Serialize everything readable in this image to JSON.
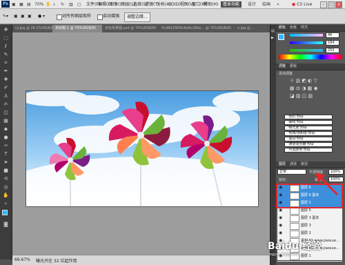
{
  "menubar": {
    "logo": "Ps",
    "menus": [
      "文件(F)",
      "编辑(E)",
      "图像(I)",
      "图层(L)",
      "选择(S)",
      "滤镜(T)",
      "分析(A)",
      "3D(D)",
      "视图(V)",
      "窗口(W)",
      "帮助(H)"
    ],
    "zoom": "70%",
    "workspace_active": "基本功能",
    "workspace_design": "设计",
    "workspace_paint": "绘画",
    "more": "»",
    "cslive": "CS Live",
    "win_min": "-",
    "win_max": "□",
    "win_close": "x"
  },
  "options": {
    "sample_all_layers": "对所有图层取样",
    "auto_enhance": "自动增强",
    "refine_edge": "调整边缘..."
  },
  "tabs": [
    "cy.jpg @ 26.2%(RGB/8...",
    "未标题-1 @ 70%(RGB/8)",
    "去色效果图.psd @ 70%(RGB/8)",
    "5cd6d1f900c6a6c18ee... @ 70%(RGB/8)",
    "x.jpg @ ..."
  ],
  "status": {
    "zoom": "66.67%",
    "doc": "曝光只在 32 位起作用"
  },
  "color_panel": {
    "tab1": "颜色",
    "tab2": "色板",
    "tab3": "样式",
    "r": "46",
    "g": "184",
    "b": "255"
  },
  "adjust_panel": {
    "tab1": "调整",
    "tab2": "蒙版",
    "title": "添加调整",
    "presets": [
      "'色阶'预设",
      "'曲线'预设",
      "'曝光度'预设",
      "'色相/饱和度'预设",
      "'黑白'预设",
      "'通道混合器'预设",
      "'可选颜色'预设"
    ]
  },
  "layers_panel": {
    "tab1": "图层",
    "tab2": "通道",
    "tab3": "路径",
    "blend_mode": "正常",
    "opacity_label": "不透明度:",
    "opacity": "100%",
    "lock_label": "锁定:",
    "fill_label": "填充:",
    "fill": "100%",
    "layers": [
      {
        "name": "图层 6",
        "selected": true
      },
      {
        "name": "图层 6 副本",
        "selected": true
      },
      {
        "name": "图层 5",
        "selected": true
      },
      {
        "name": "图层 5",
        "selected": false
      },
      {
        "name": "图层 3 副本",
        "selected": false
      },
      {
        "name": "图层 3",
        "selected": false
      },
      {
        "name": "图层 2",
        "selected": false
      },
      {
        "name": "素材 01 www.jiaoxue...",
        "selected": false
      },
      {
        "name": "素材 01 www.jiaoxue...",
        "selected": false
      },
      {
        "name": "图层 1",
        "selected": false
      }
    ],
    "watermark": "Baidu 经验",
    "watermark_url": "jingyan.baidu.com"
  },
  "colors": {
    "selection_red": "#e5262a",
    "layer_selected": "#3d8fdc",
    "sky": "#6fb4ea"
  }
}
